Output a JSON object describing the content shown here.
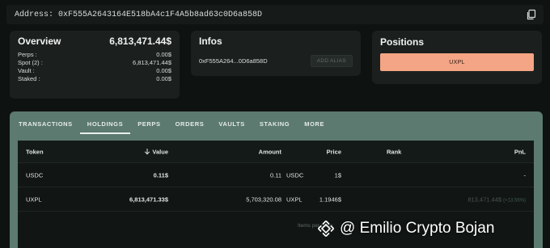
{
  "address_bar": {
    "label": "Address:",
    "value": "0xF555A2643164E518bA4c1F4A5b8ad63c0D6a858D"
  },
  "overview": {
    "title": "Overview",
    "total": "6,813,471.44$",
    "rows": [
      {
        "label": "Perps :",
        "value": "0.00$"
      },
      {
        "label": "Spot (2) :",
        "value": "6,813,471.44$"
      },
      {
        "label": "Vault :",
        "value": "0.00$"
      },
      {
        "label": "Staked :",
        "value": "0.00$"
      }
    ]
  },
  "infos": {
    "title": "Infos",
    "short_address": "0xF555A264...0D6a858D",
    "add_alias_label": "ADD ALIAS"
  },
  "positions": {
    "title": "Positions",
    "pill_label": "UXPL",
    "pill_color": "#f4a585"
  },
  "tabs": [
    {
      "label": "TRANSACTIONS"
    },
    {
      "label": "HOLDINGS",
      "active": true
    },
    {
      "label": "PERPS"
    },
    {
      "label": "ORDERS"
    },
    {
      "label": "VAULTS"
    },
    {
      "label": "STAKING"
    },
    {
      "label": "MORE"
    }
  ],
  "holdings": {
    "columns": {
      "token": "Token",
      "value": "Value",
      "amount": "Amount",
      "price": "Price",
      "rank": "Rank",
      "pnl": "PnL"
    },
    "rows": [
      {
        "token": "USDC",
        "value": "0.11$",
        "amount": "0.11",
        "amount_currency": "USDC",
        "price": "1$",
        "rank": "",
        "pnl": "-",
        "pnl_pct": ""
      },
      {
        "token": "UXPL",
        "value": "6,813,471.33$",
        "amount": "5,703,320.08",
        "amount_currency": "UXPL",
        "price": "1.1946$",
        "rank": "",
        "pnl": "813,471.44$",
        "pnl_pct": "(+13.56%)"
      }
    ]
  },
  "pager": {
    "text": "Items per page"
  },
  "watermark": {
    "text": "@ Emilio Crypto Bojan",
    "icon": "binance-square-icon"
  },
  "colors": {
    "background": "#0e1210",
    "card": "#1b201e",
    "tab_panel": "#5c7a6f",
    "accent_position": "#f4a585"
  }
}
